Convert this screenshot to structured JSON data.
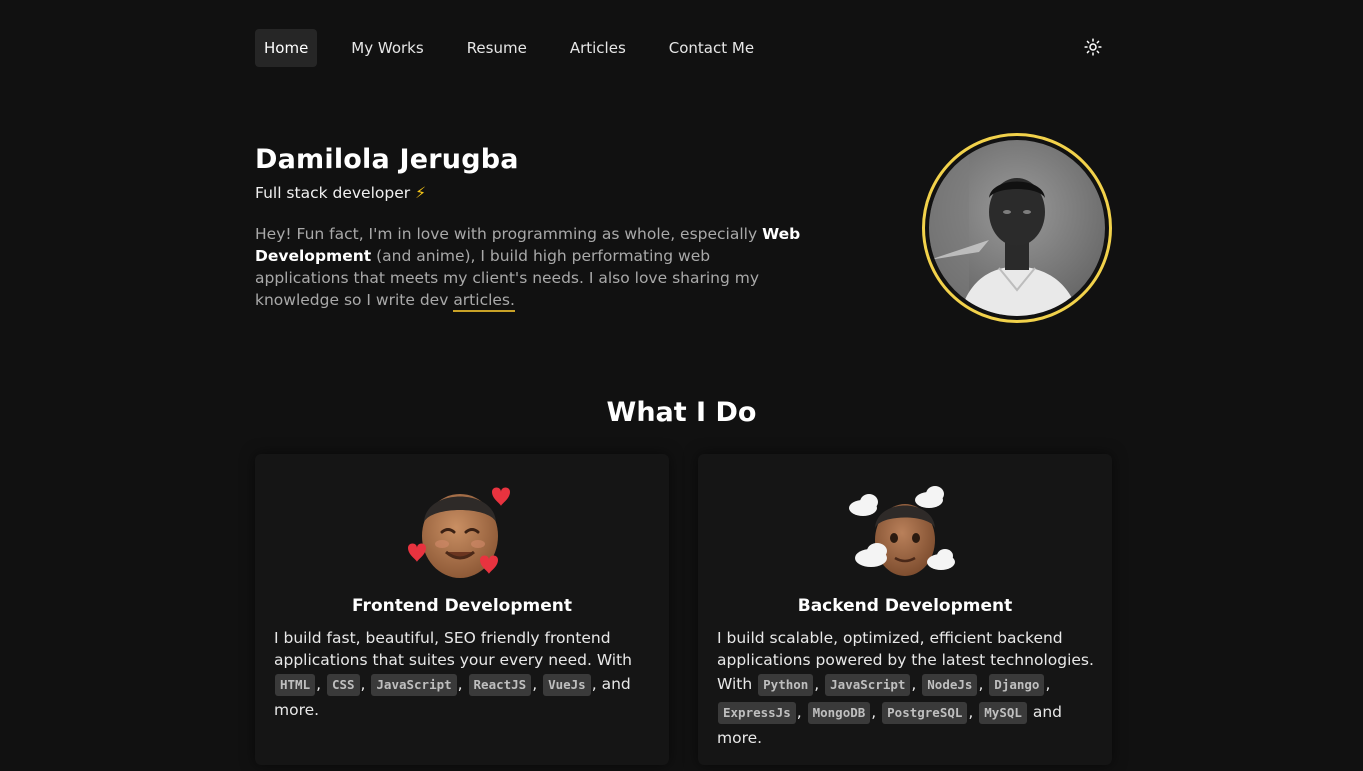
{
  "nav": {
    "items": [
      {
        "label": "Home",
        "active": true
      },
      {
        "label": "My Works",
        "active": false
      },
      {
        "label": "Resume",
        "active": false
      },
      {
        "label": "Articles",
        "active": false
      },
      {
        "label": "Contact Me",
        "active": false
      }
    ],
    "theme_toggle_icon": "sun-icon"
  },
  "hero": {
    "name": "Damilola Jerugba",
    "role": "Full stack developer",
    "role_emoji": "⚡",
    "bio_part1": "Hey! Fun fact, I'm in love with programming as whole, especially ",
    "bio_bold": "Web Development",
    "bio_part2": " (and anime), I build high performating web applications that meets my client's needs. I also love sharing my knowledge so I write dev ",
    "bio_link": "articles."
  },
  "section": {
    "title": "What I Do"
  },
  "cards": {
    "frontend": {
      "title": "Frontend Development",
      "intro": "I build fast, beautiful, SEO friendly frontend applications that suites your every need. With",
      "tags": [
        "HTML",
        "CSS",
        "JavaScript",
        "ReactJS",
        "VueJs"
      ],
      "outro": "and more."
    },
    "backend": {
      "title": "Backend Development",
      "intro": "I build scalable, optimized, efficient backend applications powered by the latest technologies. With",
      "tags": [
        "Python",
        "JavaScript",
        "NodeJs",
        "Django",
        "ExpressJs",
        "MongoDB",
        "PostgreSQL",
        "MySQL"
      ],
      "outro": "and more."
    }
  },
  "colors": {
    "background": "#111111",
    "card": "#151515",
    "accent": "#f2d24b",
    "tag_bg": "#3a3a3a"
  }
}
